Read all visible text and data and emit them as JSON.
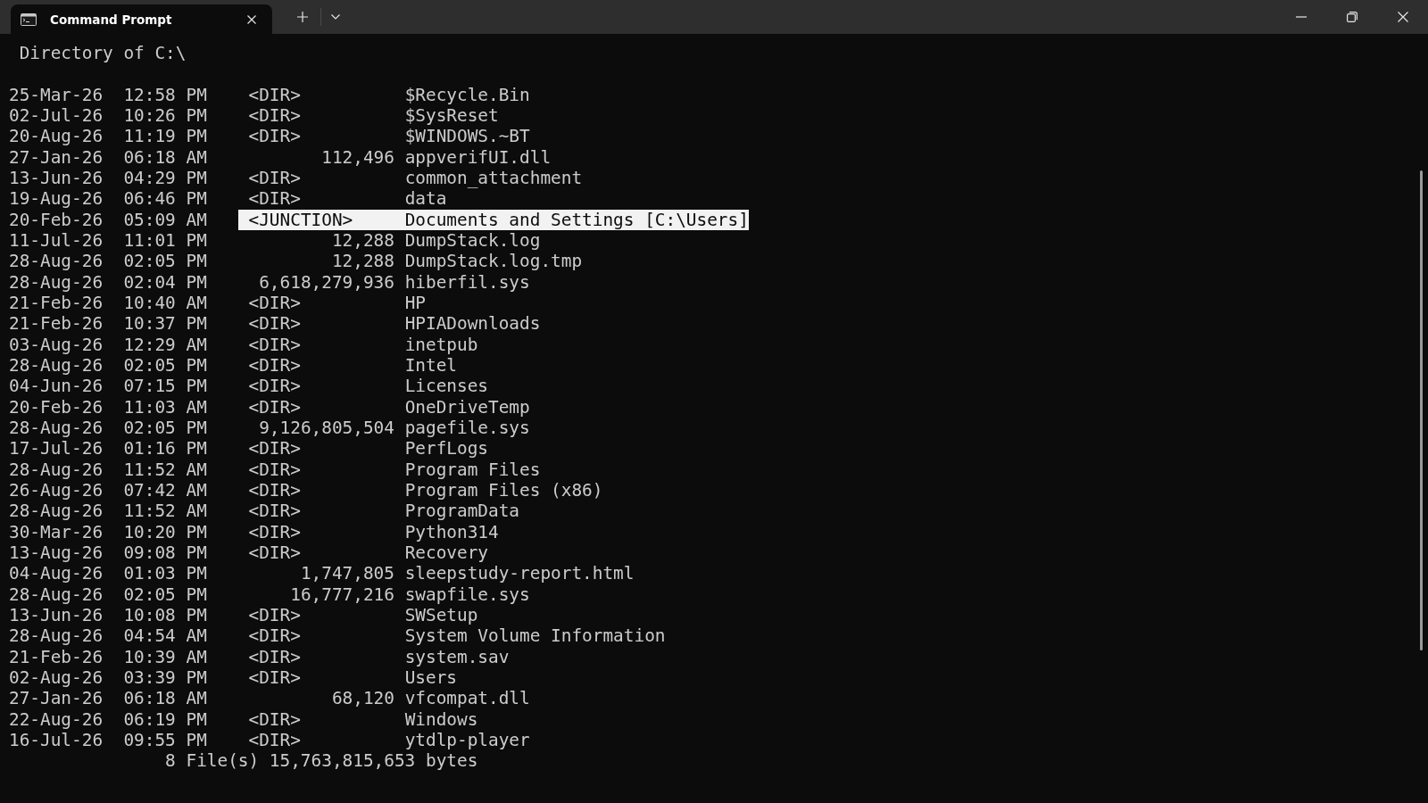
{
  "tabs": [
    {
      "label": "Command Prompt",
      "selected": true
    }
  ],
  "terminal": {
    "heading": "Directory of C:\\",
    "rows": [
      {
        "date": "25-Mar-26",
        "time": "12:58 PM",
        "kind": "dir",
        "type": "<DIR>",
        "name": "$Recycle.Bin",
        "selected": false
      },
      {
        "date": "02-Jul-26",
        "time": "10:26 PM",
        "kind": "dir",
        "type": "<DIR>",
        "name": "$SysReset",
        "selected": false
      },
      {
        "date": "20-Aug-26",
        "time": "11:19 PM",
        "kind": "dir",
        "type": "<DIR>",
        "name": "$WINDOWS.~BT",
        "selected": false
      },
      {
        "date": "27-Jan-26",
        "time": "06:18 AM",
        "kind": "file",
        "size": "112,496",
        "name": "appverifUI.dll",
        "selected": false
      },
      {
        "date": "13-Jun-26",
        "time": "04:29 PM",
        "kind": "dir",
        "type": "<DIR>",
        "name": "common_attachment",
        "selected": false
      },
      {
        "date": "19-Aug-26",
        "time": "06:46 PM",
        "kind": "dir",
        "type": "<DIR>",
        "name": "data",
        "selected": false
      },
      {
        "date": "20-Feb-26",
        "time": "05:09 AM",
        "kind": "junction",
        "type": "<JUNCTION>",
        "name": "Documents and Settings [C:\\Users]",
        "selected": true
      },
      {
        "date": "11-Jul-26",
        "time": "11:01 PM",
        "kind": "file",
        "size": "12,288",
        "name": "DumpStack.log",
        "selected": false
      },
      {
        "date": "28-Aug-26",
        "time": "02:05 PM",
        "kind": "file",
        "size": "12,288",
        "name": "DumpStack.log.tmp",
        "selected": false
      },
      {
        "date": "28-Aug-26",
        "time": "02:04 PM",
        "kind": "file",
        "size": "6,618,279,936",
        "name": "hiberfil.sys",
        "selected": false
      },
      {
        "date": "21-Feb-26",
        "time": "10:40 AM",
        "kind": "dir",
        "type": "<DIR>",
        "name": "HP",
        "selected": false
      },
      {
        "date": "21-Feb-26",
        "time": "10:37 PM",
        "kind": "dir",
        "type": "<DIR>",
        "name": "HPIADownloads",
        "selected": false
      },
      {
        "date": "03-Aug-26",
        "time": "12:29 AM",
        "kind": "dir",
        "type": "<DIR>",
        "name": "inetpub",
        "selected": false
      },
      {
        "date": "28-Aug-26",
        "time": "02:05 PM",
        "kind": "dir",
        "type": "<DIR>",
        "name": "Intel",
        "selected": false
      },
      {
        "date": "04-Jun-26",
        "time": "07:15 PM",
        "kind": "dir",
        "type": "<DIR>",
        "name": "Licenses",
        "selected": false
      },
      {
        "date": "20-Feb-26",
        "time": "11:03 AM",
        "kind": "dir",
        "type": "<DIR>",
        "name": "OneDriveTemp",
        "selected": false
      },
      {
        "date": "28-Aug-26",
        "time": "02:05 PM",
        "kind": "file",
        "size": "9,126,805,504",
        "name": "pagefile.sys",
        "selected": false
      },
      {
        "date": "17-Jul-26",
        "time": "01:16 PM",
        "kind": "dir",
        "type": "<DIR>",
        "name": "PerfLogs",
        "selected": false
      },
      {
        "date": "28-Aug-26",
        "time": "11:52 AM",
        "kind": "dir",
        "type": "<DIR>",
        "name": "Program Files",
        "selected": false
      },
      {
        "date": "26-Aug-26",
        "time": "07:42 AM",
        "kind": "dir",
        "type": "<DIR>",
        "name": "Program Files (x86)",
        "selected": false
      },
      {
        "date": "28-Aug-26",
        "time": "11:52 AM",
        "kind": "dir",
        "type": "<DIR>",
        "name": "ProgramData",
        "selected": false
      },
      {
        "date": "30-Mar-26",
        "time": "10:20 PM",
        "kind": "dir",
        "type": "<DIR>",
        "name": "Python314",
        "selected": false
      },
      {
        "date": "13-Aug-26",
        "time": "09:08 PM",
        "kind": "dir",
        "type": "<DIR>",
        "name": "Recovery",
        "selected": false
      },
      {
        "date": "04-Aug-26",
        "time": "01:03 PM",
        "kind": "file",
        "size": "1,747,805",
        "name": "sleepstudy-report.html",
        "selected": false
      },
      {
        "date": "28-Aug-26",
        "time": "02:05 PM",
        "kind": "file",
        "size": "16,777,216",
        "name": "swapfile.sys",
        "selected": false
      },
      {
        "date": "13-Jun-26",
        "time": "10:08 PM",
        "kind": "dir",
        "type": "<DIR>",
        "name": "SWSetup",
        "selected": false
      },
      {
        "date": "28-Aug-26",
        "time": "04:54 AM",
        "kind": "dir",
        "type": "<DIR>",
        "name": "System Volume Information",
        "selected": false
      },
      {
        "date": "21-Feb-26",
        "time": "10:39 AM",
        "kind": "dir",
        "type": "<DIR>",
        "name": "system.sav",
        "selected": false
      },
      {
        "date": "02-Aug-26",
        "time": "03:39 PM",
        "kind": "dir",
        "type": "<DIR>",
        "name": "Users",
        "selected": false
      },
      {
        "date": "27-Jan-26",
        "time": "06:18 AM",
        "kind": "file",
        "size": "68,120",
        "name": "vfcompat.dll",
        "selected": false
      },
      {
        "date": "22-Aug-26",
        "time": "06:19 PM",
        "kind": "dir",
        "type": "<DIR>",
        "name": "Windows",
        "selected": false
      },
      {
        "date": "16-Jul-26",
        "time": "09:55 PM",
        "kind": "dir",
        "type": "<DIR>",
        "name": "ytdlp-player",
        "selected": false
      }
    ],
    "summary": "8 File(s) 15,763,815,653 bytes"
  }
}
